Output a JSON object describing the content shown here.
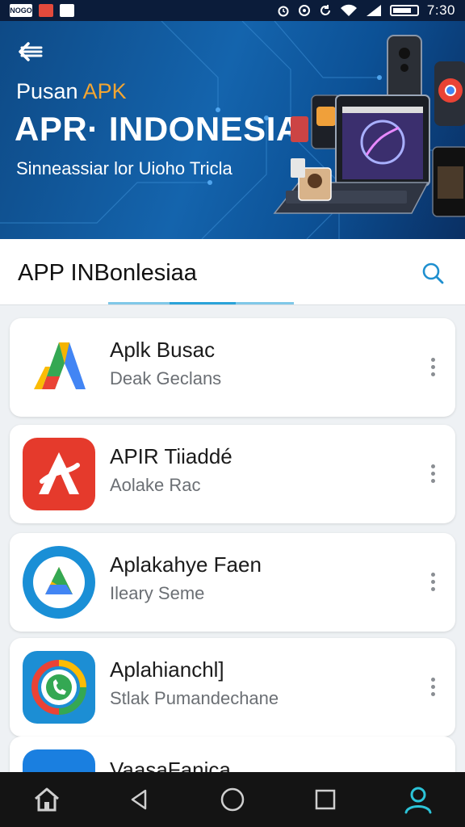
{
  "status_bar": {
    "left_icons": [
      "notification-icon",
      "app-icon",
      "shield-icon"
    ],
    "left_icon_labels": [
      "NOGO",
      "",
      ""
    ],
    "right_icons": [
      "alarm-icon",
      "timer-icon",
      "sync-icon",
      "wifi-icon",
      "signal-icon",
      "battery-icon"
    ],
    "time": "7:30"
  },
  "banner": {
    "subtitle_prefix": "Pusan ",
    "subtitle_accent": "APK",
    "title": "APR· INDONESIA",
    "tagline": "Sinneassiar lor Uioho Tricla",
    "back_icon": "back-arrow-icon",
    "colors": {
      "accent": "#f3a531",
      "bg_start": "#0e4a86",
      "bg_end": "#0a2f63"
    }
  },
  "header": {
    "title": "APP INBonlesiaa",
    "search_icon": "search-icon",
    "tab_indicator_color": "#2aa3d9"
  },
  "apps": [
    {
      "name": "Aplk Busac",
      "description": "Deak Geclans",
      "icon": "triangle-logo-icon"
    },
    {
      "name": "APIR Tiiaddé",
      "description": "Aolake Rac",
      "icon": "red-a-logo-icon"
    },
    {
      "name": "Aplakahye Faen",
      "description": "Ileary Seme",
      "icon": "blue-circle-triangle-icon"
    },
    {
      "name": "Aplahianchl]",
      "description": "Stlak Pumandechane",
      "icon": "phone-chat-icon"
    },
    {
      "name": "VaasaFanica",
      "description": "",
      "icon": "blue-app-icon"
    }
  ],
  "bottom_nav": {
    "items": [
      "home-icon",
      "back-icon",
      "home-circle-icon",
      "recents-icon",
      "profile-icon"
    ],
    "active_color": "#2cc4d8"
  }
}
